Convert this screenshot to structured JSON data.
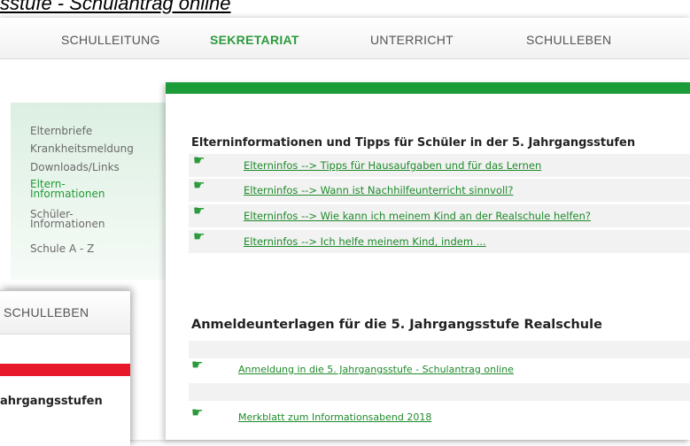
{
  "caption": "sstufe - Schulantrag online",
  "top_nav": [
    {
      "label": "SCHULLEITUNG",
      "active": false
    },
    {
      "label": "SEKRETARIAT",
      "active": true
    },
    {
      "label": "UNTERRICHT",
      "active": false
    },
    {
      "label": "SCHULLEBEN",
      "active": false
    }
  ],
  "sidebar": [
    {
      "label": "Elternbriefe"
    },
    {
      "label": "Krankheitsmeldung"
    },
    {
      "label": "Downloads/Links"
    },
    {
      "label": "Eltern-\nInformationen",
      "active": true
    },
    {
      "label": "Schüler-\nInformationen"
    },
    {
      "label": "Schule A - Z"
    }
  ],
  "section1": {
    "heading": "Elterninformationen und Tipps für Schüler in der 5. Jahrgangsstufen",
    "links": [
      "Elterninfos --> Tipps für Hausaufgaben und für das Lernen",
      "Elterninfos --> Wann ist Nachhilfeunterricht sinnvoll?",
      "Elterninfos --> Wie kann ich meinem Kind an der Realschule helfen?",
      "Elterninfos --> Ich helfe meinem Kind, indem ..."
    ]
  },
  "section2": {
    "heading": "Anmeldeunterlagen für die 5. Jahrgangsstufe Realschule",
    "links": [
      "Anmeldung in die 5. Jahrgangsstufe - Schulantrag online",
      "Merkblatt zum Informationsabend 2018"
    ]
  },
  "overlay": {
    "nav_label": "SCHULLEBEN",
    "text": "ahrgangsstufen"
  },
  "colors": {
    "accent_green": "#1c9b39",
    "link_green": "#1e8a2a",
    "red_bar": "#e8182b"
  },
  "icons": {
    "link_bullet": "pointing-hand-icon"
  }
}
